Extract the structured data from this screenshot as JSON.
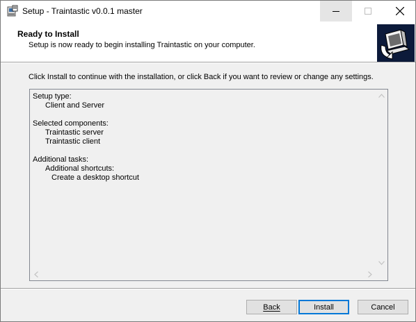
{
  "window": {
    "title": "Setup - Traintastic v0.0.1 master",
    "controls": {
      "minimize": "minimize",
      "maximize": "maximize",
      "close": "close"
    }
  },
  "header": {
    "title": "Ready to Install",
    "subtitle": "Setup is now ready to begin installing Traintastic on your computer.",
    "icon": "installer-computer-icon"
  },
  "instruction": "Click Install to continue with the installation, or click Back if you want to review or change any settings.",
  "summary": {
    "setup_type_label": "Setup type:",
    "setup_type_value": "Client and Server",
    "components_label": "Selected components:",
    "components": [
      "Traintastic server",
      "Traintastic client"
    ],
    "tasks_label": "Additional tasks:",
    "tasks_group": "Additional shortcuts:",
    "tasks": [
      "Create a desktop shortcut"
    ]
  },
  "buttons": {
    "back": "Back",
    "install": "Install",
    "cancel": "Cancel"
  },
  "colors": {
    "dialog_bg": "#f0f0f0",
    "default_button_border": "#0078d7"
  }
}
